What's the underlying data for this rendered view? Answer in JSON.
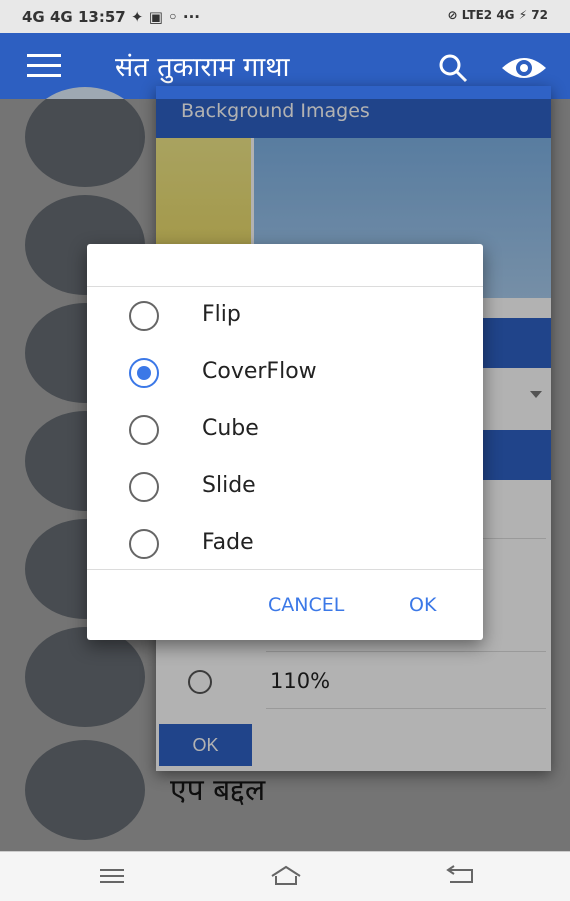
{
  "status_bar": {
    "left_text": "4G 4G 13:57 ✦ ▣ ◦ ···",
    "right_text": "⊘ LTE2 4G ⚡ 72"
  },
  "app_bar": {
    "title": "संत तुकाराम गाथा",
    "menu_icon": "hamburger-icon",
    "search_icon": "search-icon",
    "eye_icon": "eye-icon",
    "color": "#2d5fc1"
  },
  "list": {
    "last_item_label": "एप बद्दल"
  },
  "bg_dialog": {
    "title": "Background Images",
    "option_110_label": "110%",
    "ok_label": "OK"
  },
  "transition_dialog": {
    "options": [
      {
        "label": "Flip",
        "selected": false
      },
      {
        "label": "CoverFlow",
        "selected": true
      },
      {
        "label": "Cube",
        "selected": false
      },
      {
        "label": "Slide",
        "selected": false
      },
      {
        "label": "Fade",
        "selected": false
      }
    ],
    "cancel_label": "CANCEL",
    "ok_label": "OK",
    "accent": "#3b78e7"
  },
  "nav_bar": {
    "icons": [
      "menu-nav-icon",
      "home-nav-icon",
      "back-nav-icon"
    ]
  }
}
